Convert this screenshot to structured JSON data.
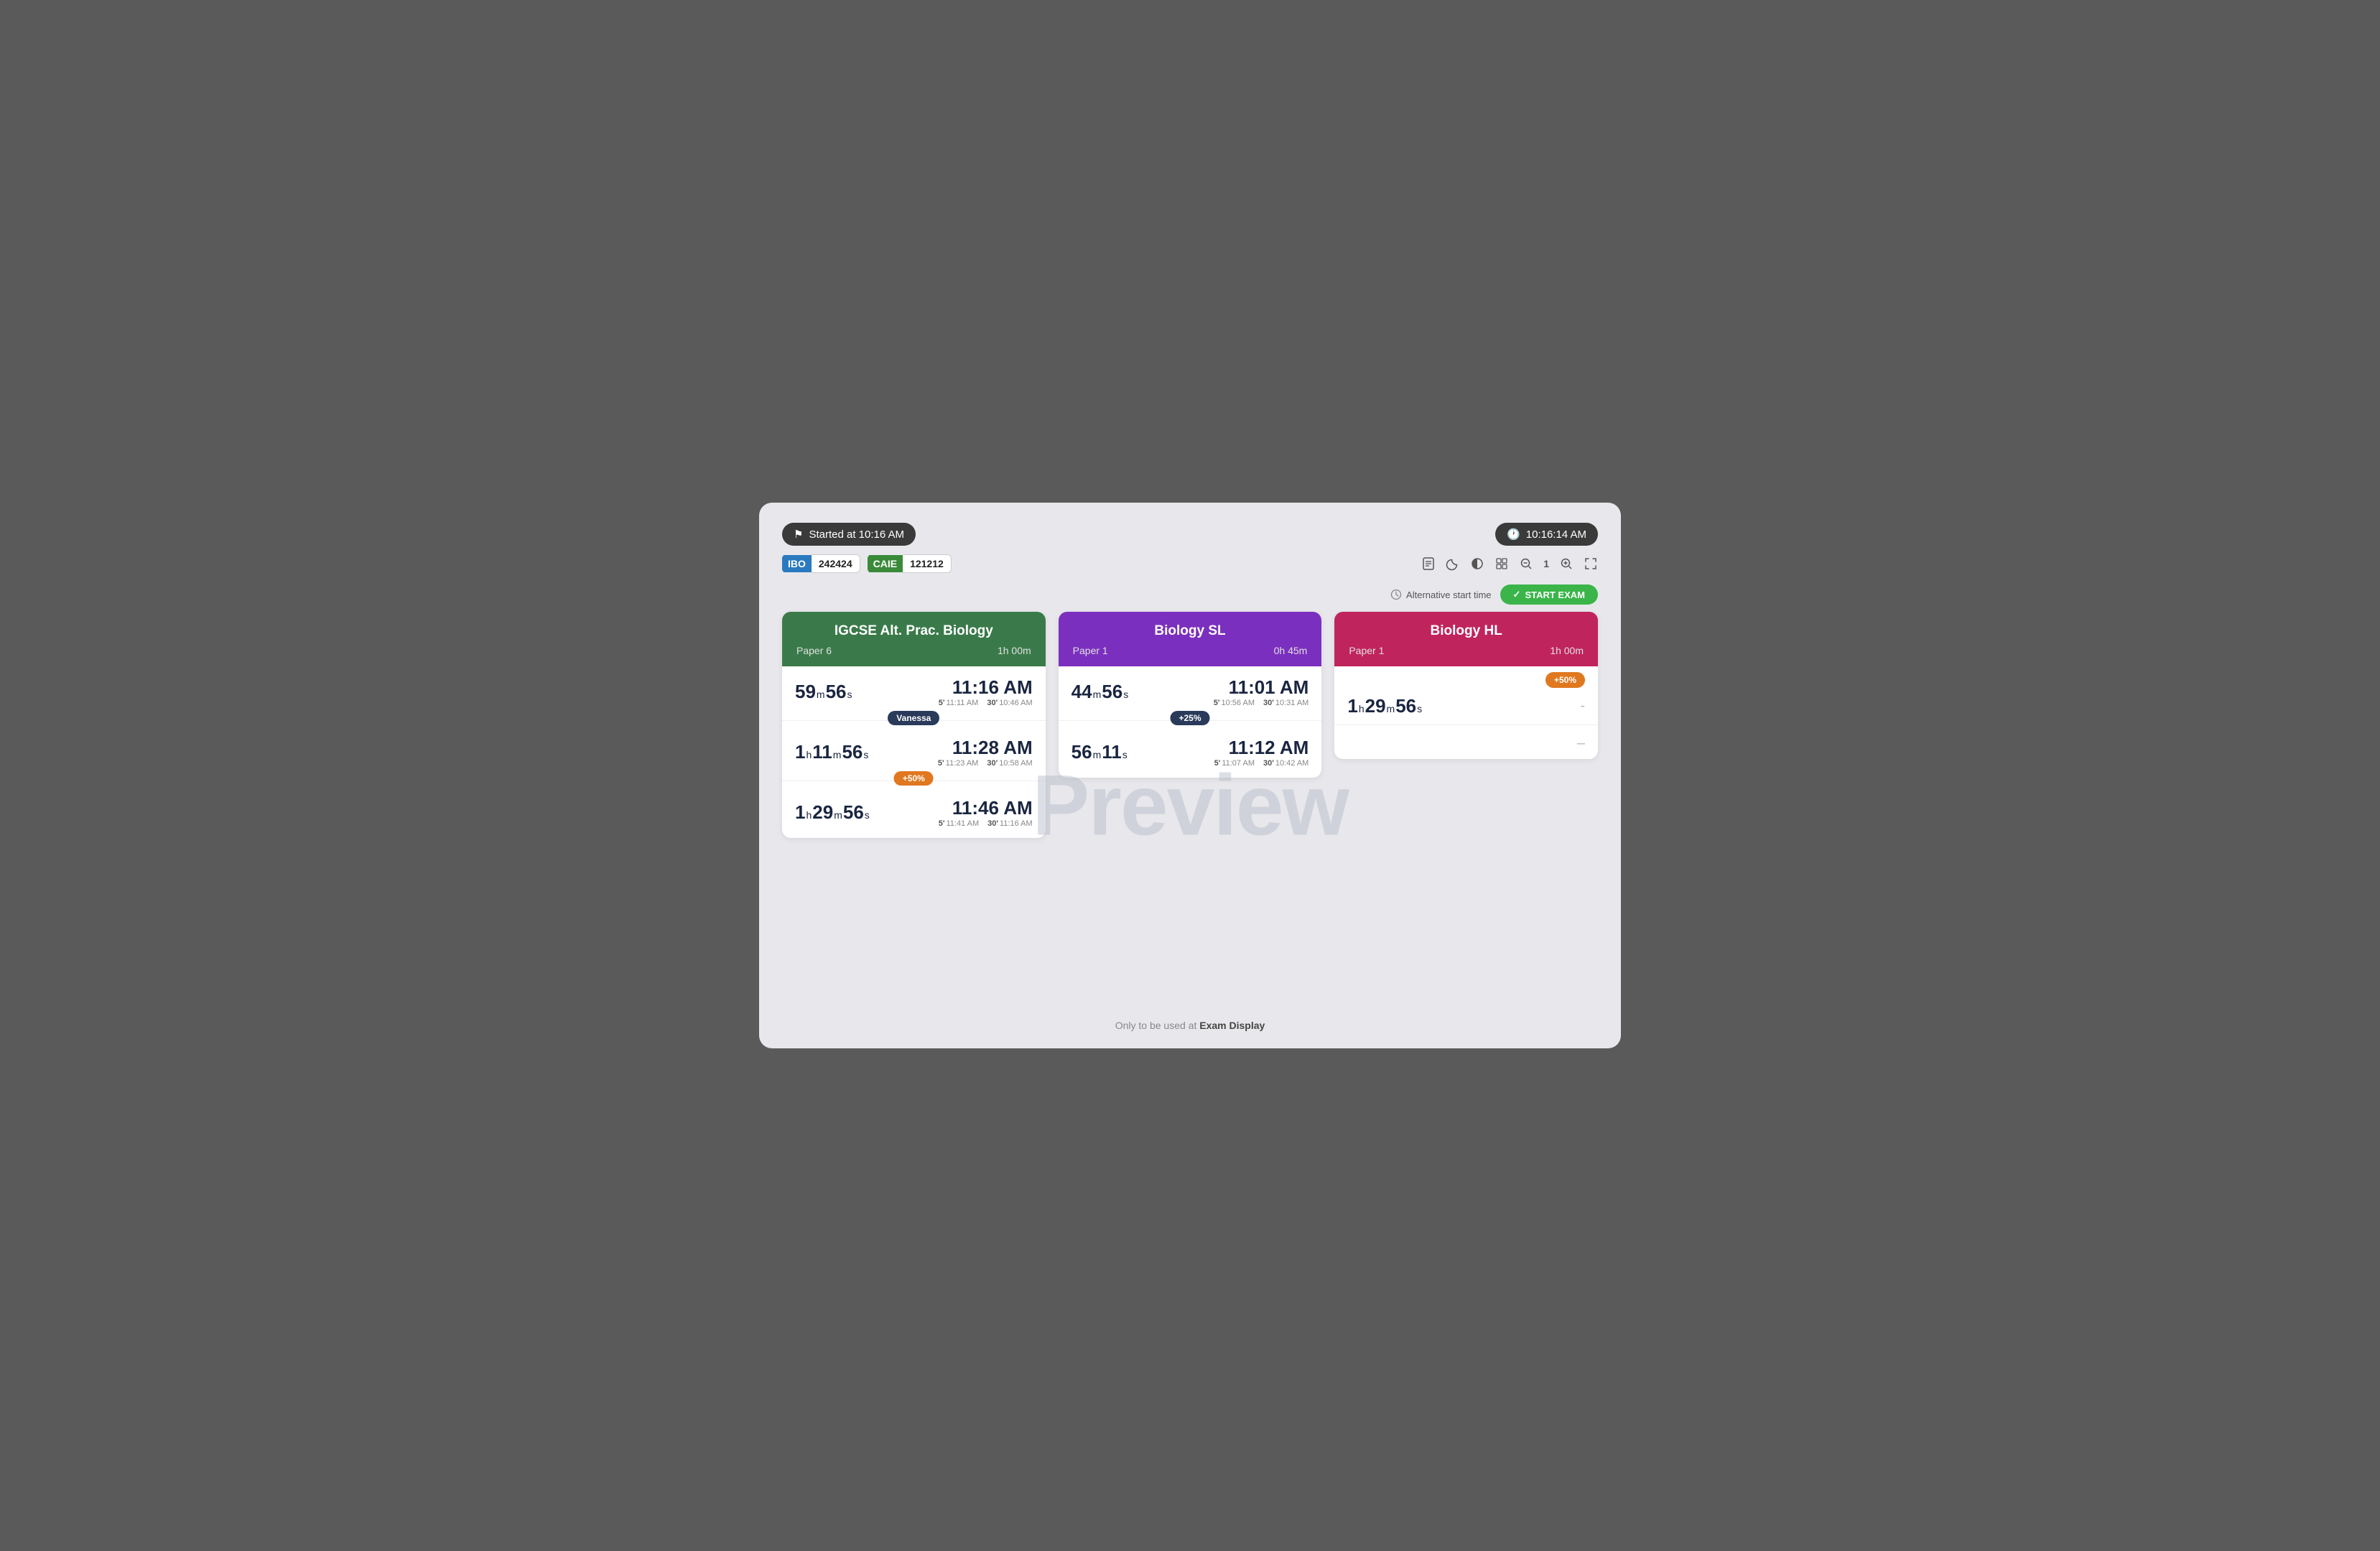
{
  "header": {
    "started_label": "Started at 10:16 AM",
    "clock_label": "10:16:14 AM"
  },
  "tags": {
    "ibo_label": "IBO",
    "ibo_value": "242424",
    "caie_label": "CAIE",
    "caie_value": "121212"
  },
  "toolbar": {
    "icons": [
      "⬜",
      "🌙",
      "◑",
      "⊞",
      "🔍",
      "1",
      "🔍",
      "⤢"
    ]
  },
  "alt_start": {
    "label": "Alternative start time",
    "button_label": "START EXAM"
  },
  "cards": [
    {
      "id": "igcse-card",
      "title": "IGCSE Alt. Prac. Biology",
      "paper": "Paper 6",
      "duration": "1h 00m",
      "color": "green",
      "rows": [
        {
          "time_left": "59",
          "time_left_unit_m": "m",
          "time_left_sec": "56",
          "time_left_unit_s": "s",
          "end_time": "11:16 AM",
          "sub1_label": "5'",
          "sub1_val": "11:11 AM",
          "sub2_label": "30'",
          "sub2_val": "10:46 AM",
          "badge": null
        },
        {
          "time_left": "1",
          "time_left_unit_h": "h",
          "time_left_m": "11",
          "time_left_unit_m": "m",
          "time_left_sec": "56",
          "time_left_unit_s": "s",
          "end_time": "11:28 AM",
          "sub1_label": "5'",
          "sub1_val": "11:23 AM",
          "sub2_label": "30'",
          "sub2_val": "10:58 AM",
          "badge": {
            "text": "Vanessa",
            "type": "dark"
          }
        },
        {
          "time_left": "1",
          "time_left_unit_h": "h",
          "time_left_m": "29",
          "time_left_unit_m": "m",
          "time_left_sec": "56",
          "time_left_unit_s": "s",
          "end_time": "11:46 AM",
          "sub1_label": "5'",
          "sub1_val": "11:41 AM",
          "sub2_label": "30'",
          "sub2_val": "11:16 AM",
          "badge": {
            "text": "+50%",
            "type": "orange"
          }
        }
      ]
    },
    {
      "id": "biology-sl-card",
      "title": "Biology SL",
      "paper": "Paper 1",
      "duration": "0h 45m",
      "color": "purple",
      "rows": [
        {
          "time_left": "44",
          "time_left_unit_m": "m",
          "time_left_sec": "56",
          "time_left_unit_s": "s",
          "end_time": "11:01 AM",
          "sub1_label": "5'",
          "sub1_val": "10:56 AM",
          "sub2_label": "30'",
          "sub2_val": "10:31 AM",
          "badge": null
        },
        {
          "time_left": "56",
          "time_left_unit_m": "m",
          "time_left_sec": "11",
          "time_left_unit_s": "s",
          "end_time": "11:12 AM",
          "sub1_label": "5'",
          "sub1_val": "11:07 AM",
          "sub2_label": "30'",
          "sub2_val": "10:42 AM",
          "badge": {
            "text": "+25%",
            "type": "dark"
          }
        }
      ]
    },
    {
      "id": "biology-hl-card",
      "title": "Biology HL",
      "paper": "Paper 1",
      "duration": "1h 00m",
      "color": "pink",
      "plus50_badge": "+50%",
      "row": {
        "time_left": "1",
        "time_left_unit_h": "h",
        "time_left_m": "29",
        "time_left_unit_m": "m",
        "time_left_sec": "56",
        "time_left_unit_s": "s",
        "dash1": "-",
        "dash2": "–"
      }
    }
  ],
  "preview_watermark": "Preview",
  "footer": {
    "text": "Only to be used at ",
    "brand": "Exam Display"
  }
}
